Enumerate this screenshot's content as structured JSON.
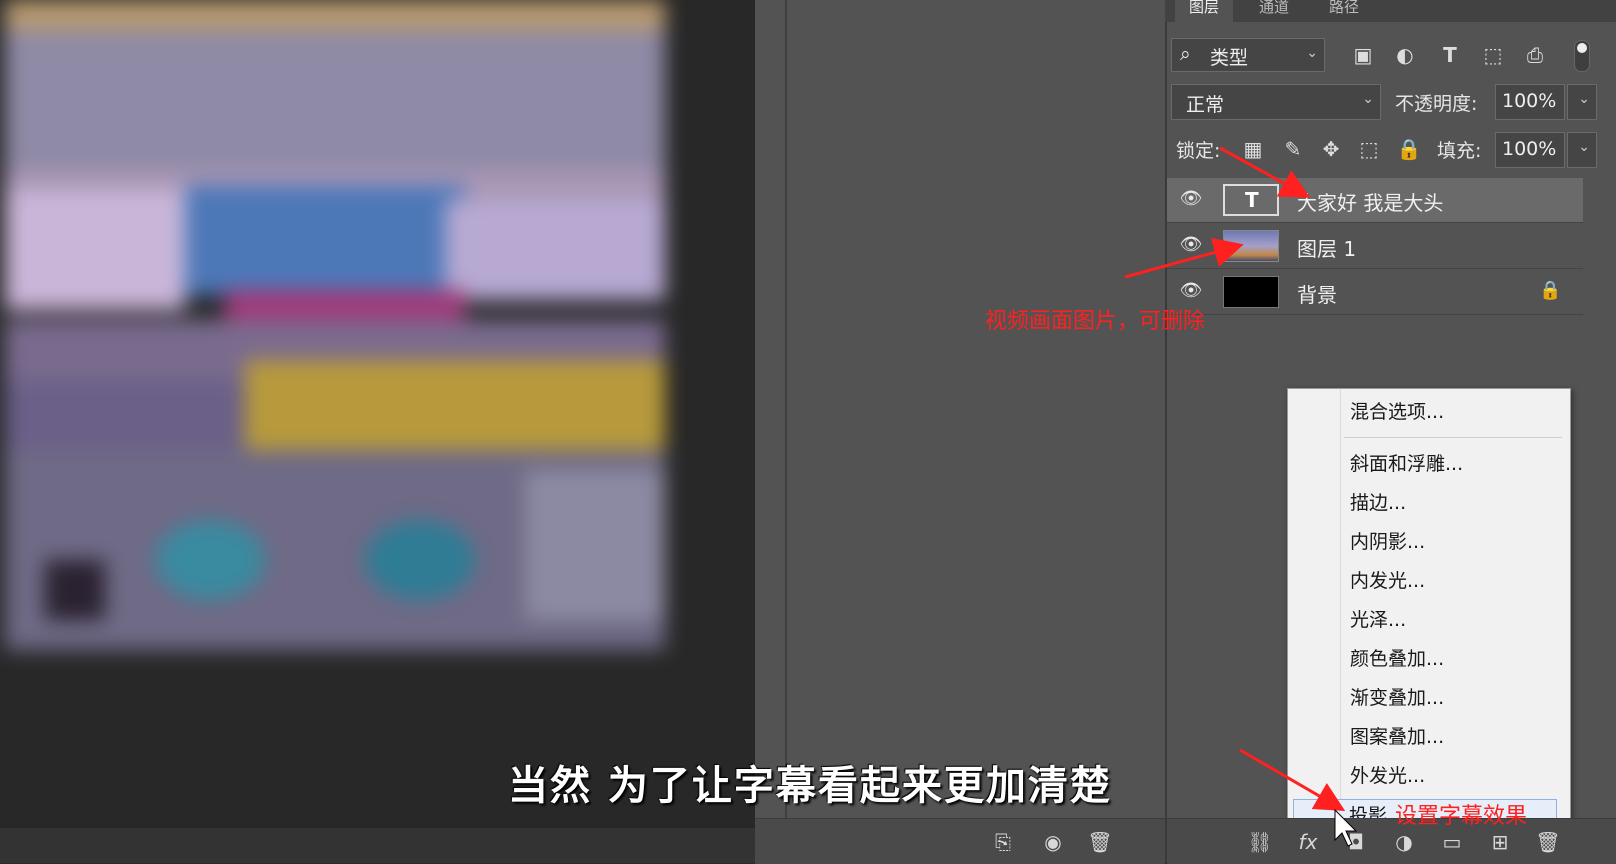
{
  "tabs": [
    "图层",
    "通道",
    "路径"
  ],
  "filter": {
    "kind_label": "类型"
  },
  "blend": {
    "mode": "正常",
    "opacity_label": "不透明度:",
    "opacity_value": "100%"
  },
  "lock": {
    "label": "锁定:",
    "fill_label": "填充:",
    "fill_value": "100%"
  },
  "layers": [
    {
      "name": "大家好 我是大头",
      "type": "text",
      "thumb_glyph": "T"
    },
    {
      "name": "图层 1",
      "type": "image"
    },
    {
      "name": "背景",
      "type": "background"
    }
  ],
  "context_menu": {
    "items": [
      "混合选项...",
      "斜面和浮雕...",
      "描边...",
      "内阴影...",
      "内发光...",
      "光泽...",
      "颜色叠加...",
      "渐变叠加...",
      "图案叠加...",
      "外发光...",
      "投影..."
    ]
  },
  "annotations": {
    "delete_note": "视频画面图片，可删除",
    "effect_note": "设置字幕效果"
  },
  "subtitle": "当然 为了让字幕看起来更加清楚",
  "colors": {
    "annotation": "#ff2020",
    "panel": "#535353",
    "selected_row": "#6a6a6a",
    "menu_bg": "#f1f1f1"
  }
}
